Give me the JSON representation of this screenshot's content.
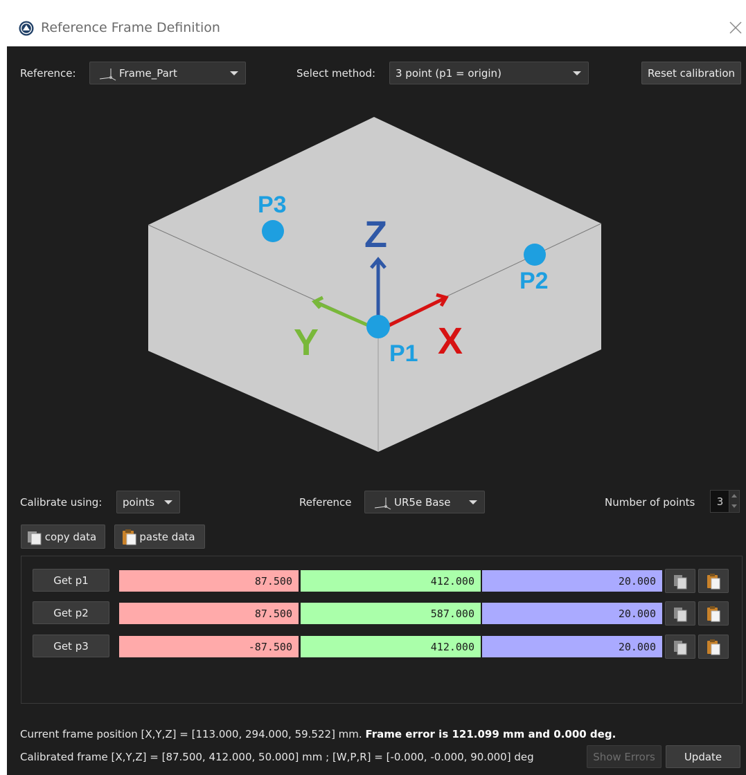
{
  "window": {
    "title": "Reference Frame Definition"
  },
  "top_bar": {
    "reference_label": "Reference:",
    "reference_value": "Frame_Part",
    "method_label": "Select method:",
    "method_value": "3 point (p1 = origin)",
    "reset_button": "Reset calibration"
  },
  "illustration": {
    "p1": "P1",
    "p2": "P2",
    "p3": "P3",
    "axis_x": "X",
    "axis_y": "Y",
    "axis_z": "Z",
    "colors": {
      "box_face": "#cccccc",
      "point": "#1e9fe0",
      "x_axis": "#d71212",
      "y_axis": "#79b83a",
      "z_axis": "#2f58a6"
    }
  },
  "calibration": {
    "using_label": "Calibrate using:",
    "using_value": "points",
    "reference_label": "Reference",
    "reference_value": "UR5e Base",
    "num_points_label": "Number of points",
    "num_points_value": "3",
    "copy_data": "copy data",
    "paste_data": "paste data"
  },
  "points": [
    {
      "button": "Get p1",
      "x": "87.500",
      "y": "412.000",
      "z": "20.000"
    },
    {
      "button": "Get p2",
      "x": "87.500",
      "y": "587.000",
      "z": "20.000"
    },
    {
      "button": "Get p3",
      "x": "-87.500",
      "y": "412.000",
      "z": "20.000"
    }
  ],
  "status": {
    "current_prefix": "Current frame position [X,Y,Z] = [113.000, 294.000, 59.522] mm. ",
    "current_error": "Frame error is 121.099 mm and 0.000 deg.",
    "calibrated": "Calibrated frame [X,Y,Z] = [87.500, 412.000, 50.000] mm ; [W,P,R] = [-0.000, -0.000, 90.000] deg",
    "show_errors": "Show Errors",
    "update": "Update"
  }
}
